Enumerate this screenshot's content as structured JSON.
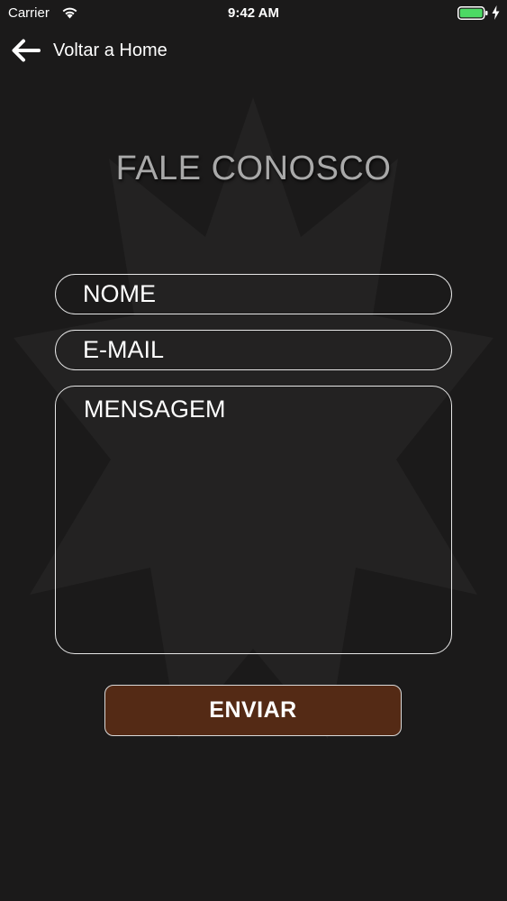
{
  "status_bar": {
    "carrier": "Carrier",
    "time": "9:42 AM",
    "icons": [
      "wifi-icon",
      "battery-icon",
      "charging-bolt-icon"
    ],
    "battery_color": "#4cd964"
  },
  "nav": {
    "back_label": "Voltar a Home",
    "back_icon": "arrow-left-icon"
  },
  "page": {
    "title": "FALE CONOSCO"
  },
  "form": {
    "name_placeholder": "NOME",
    "email_placeholder": "E-MAIL",
    "message_placeholder": "MENSAGEM",
    "submit_label": "ENVIAR"
  },
  "colors": {
    "background": "#1b1a1a",
    "title": "#a9a9a9",
    "field_border": "#e6e6e6",
    "button_fill": "#542a15"
  }
}
